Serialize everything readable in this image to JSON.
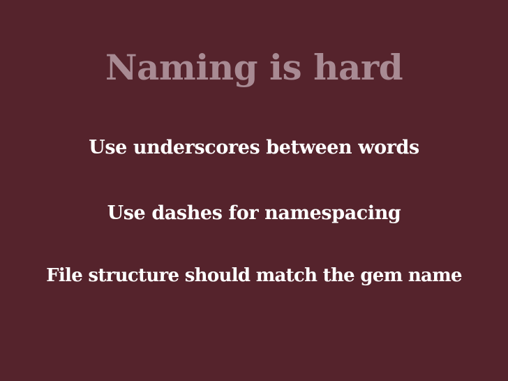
{
  "slide": {
    "title": "Naming is hard",
    "points": [
      "Use underscores between words",
      "Use dashes for namespacing",
      "File structure should match the gem name"
    ]
  },
  "colors": {
    "background": "#55232c",
    "title": "#a88a93",
    "text": "#ffffff"
  }
}
